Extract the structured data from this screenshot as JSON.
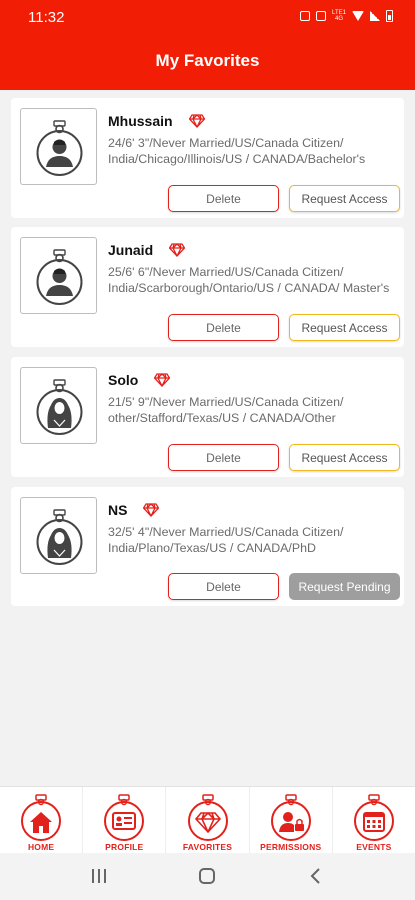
{
  "status_bar": {
    "time": "11:32",
    "net_label": "LTE1 4G"
  },
  "header": {
    "title": "My Favorites"
  },
  "favorites": [
    {
      "name": "Mhussain",
      "avatar": "male-avatar",
      "details": "24/6' 3\"/Never Married/US/Canada Citizen/ India/Chicago/Illinois/US / CANADA/Bachelor's",
      "delete_label": "Delete",
      "action_label": "Request Access",
      "action_state": "request"
    },
    {
      "name": "Junaid",
      "avatar": "male-avatar",
      "details": "25/6' 6\"/Never Married/US/Canada Citizen/ India/Scarborough/Ontario/US / CANADA/ Master's",
      "delete_label": "Delete",
      "action_label": "Request Access",
      "action_state": "request"
    },
    {
      "name": "Solo",
      "avatar": "female-avatar",
      "details": "21/5' 9\"/Never Married/US/Canada Citizen/ other/Stafford/Texas/US / CANADA/Other",
      "delete_label": "Delete",
      "action_label": "Request Access",
      "action_state": "request"
    },
    {
      "name": "NS",
      "avatar": "female-avatar",
      "details": "32/5' 4\"/Never Married/US/Canada Citizen/ India/Plano/Texas/US / CANADA/PhD",
      "delete_label": "Delete",
      "action_label": "Request Pending",
      "action_state": "pending"
    }
  ],
  "bottom_nav": [
    {
      "label": "HOME",
      "icon": "home-icon"
    },
    {
      "label": "PROFILE",
      "icon": "profile-card-icon"
    },
    {
      "label": "FAVORITES",
      "icon": "diamond-icon"
    },
    {
      "label": "PERMISSIONS",
      "icon": "user-lock-icon"
    },
    {
      "label": "EVENTS",
      "icon": "calendar-icon"
    }
  ],
  "colors": {
    "brand_red": "#f21d05",
    "delete_border": "#e3211c",
    "request_border": "#f0b81e",
    "pending_bg": "#9e9e9e"
  }
}
